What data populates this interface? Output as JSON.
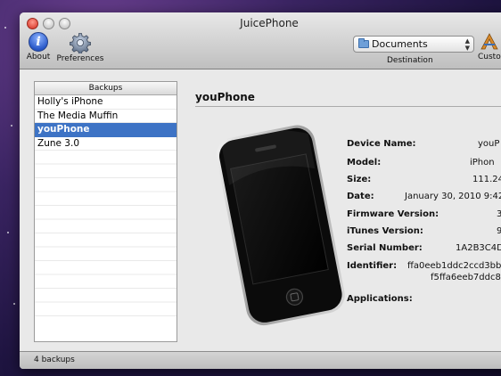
{
  "window": {
    "title": "JuicePhone"
  },
  "toolbar": {
    "about_label": "About",
    "about_glyph": "i",
    "preferences_label": "Preferences",
    "destination_value": "Documents",
    "destination_label": "Destination",
    "custom_label": "Custo"
  },
  "sidebar": {
    "header": "Backups",
    "items": [
      {
        "label": "Holly's iPhone"
      },
      {
        "label": "The Media Muffin"
      },
      {
        "label": "youPhone"
      },
      {
        "label": "Zune 3.0"
      }
    ],
    "selected_index": 2
  },
  "detail": {
    "title": "youPhone",
    "fields": [
      {
        "label": "Device Name:",
        "value": "youP"
      },
      {
        "label": "Model:",
        "value": "iPhon"
      },
      {
        "label": "Size:",
        "value": "111.24"
      },
      {
        "label": "Date:",
        "value": "January 30, 2010 9:42"
      },
      {
        "label": "Firmware Version:",
        "value": "3"
      },
      {
        "label": "iTunes Version:",
        "value": "9"
      },
      {
        "label": "Serial Number:",
        "value": "1A2B3C4D"
      },
      {
        "label": "Identifier:",
        "value": "ffa0eeb1ddc2ccd3bbe",
        "value2": "f5ffa6eeb7ddc8c"
      },
      {
        "label": "Applications:",
        "value": ""
      }
    ]
  },
  "status": {
    "text": "4 backups"
  },
  "colors": {
    "selection": "#3d73c5",
    "accent_blue": "#2a59c9"
  }
}
